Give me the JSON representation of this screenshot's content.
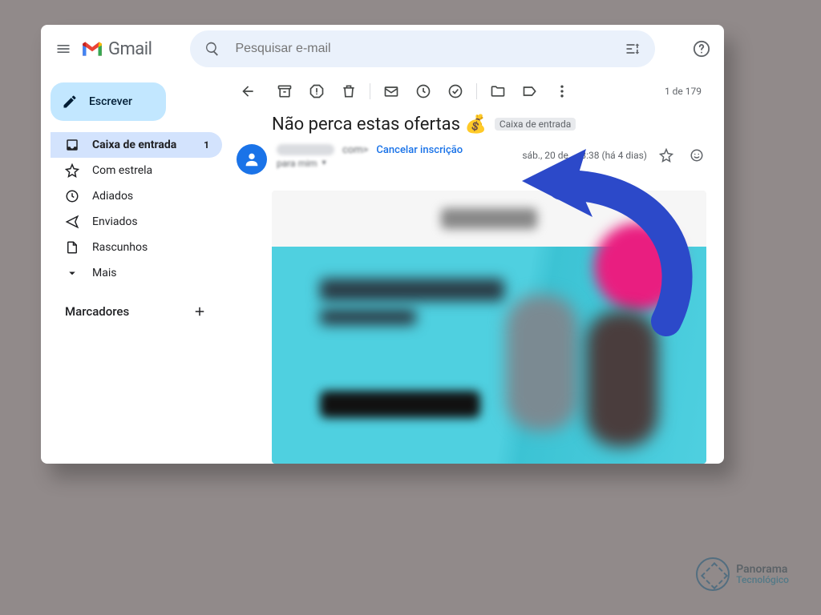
{
  "app": {
    "name": "Gmail"
  },
  "search": {
    "placeholder": "Pesquisar e-mail"
  },
  "compose": {
    "label": "Escrever"
  },
  "sidebar": {
    "items": [
      {
        "id": "inbox",
        "label": "Caixa de entrada",
        "count": "1",
        "active": true
      },
      {
        "id": "starred",
        "label": "Com estrela"
      },
      {
        "id": "snoozed",
        "label": "Adiados"
      },
      {
        "id": "sent",
        "label": "Enviados"
      },
      {
        "id": "drafts",
        "label": "Rascunhos"
      },
      {
        "id": "more",
        "label": "Mais"
      }
    ],
    "labels_header": "Marcadores"
  },
  "toolbar": {
    "page_count": "1 de 179"
  },
  "message": {
    "subject": "Não perca estas ofertas 💰",
    "category_chip": "Caixa de entrada",
    "sender_email_suffix": "com>",
    "unsubscribe": "Cancelar inscrição",
    "to_line": "para mim",
    "date": "sáb., 20 de ... 3:38 (há 4 dias)"
  },
  "watermark": {
    "line1": "Panorama",
    "line2": "Tecnológico"
  }
}
